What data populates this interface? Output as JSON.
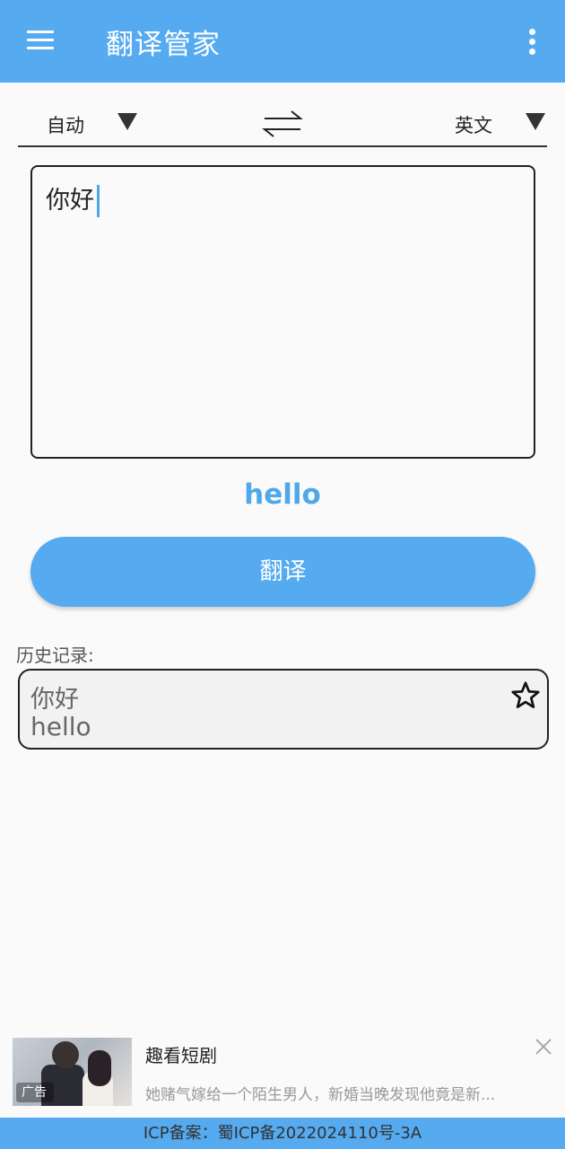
{
  "app_bar": {
    "title": "翻译管家",
    "menu_icon": "hamburger-menu-icon",
    "more_icon": "more-vertical-icon",
    "color": "#55aaf0"
  },
  "language_bar": {
    "source_language": "自动",
    "target_language": "英文",
    "swap_icon": "swap-arrows-icon",
    "dropdown_icon": "triangle-down-icon"
  },
  "input": {
    "value": "你好"
  },
  "result": {
    "text": "hello",
    "color": "#4ea8ea"
  },
  "translate_button": {
    "label": "翻译"
  },
  "history": {
    "label": "历史记录:",
    "items": [
      {
        "source": "你好",
        "target": "hello",
        "favorite_icon": "star-outline-icon"
      }
    ]
  },
  "ad": {
    "badge": "广告",
    "title": "趣看短剧",
    "description": "她赌气嫁给一个陌生男人，新婚当晚发现他竟是新...",
    "close_icon": "close-icon"
  },
  "footer": {
    "text": "ICP备案：蜀ICP备2022024110号-3A"
  }
}
